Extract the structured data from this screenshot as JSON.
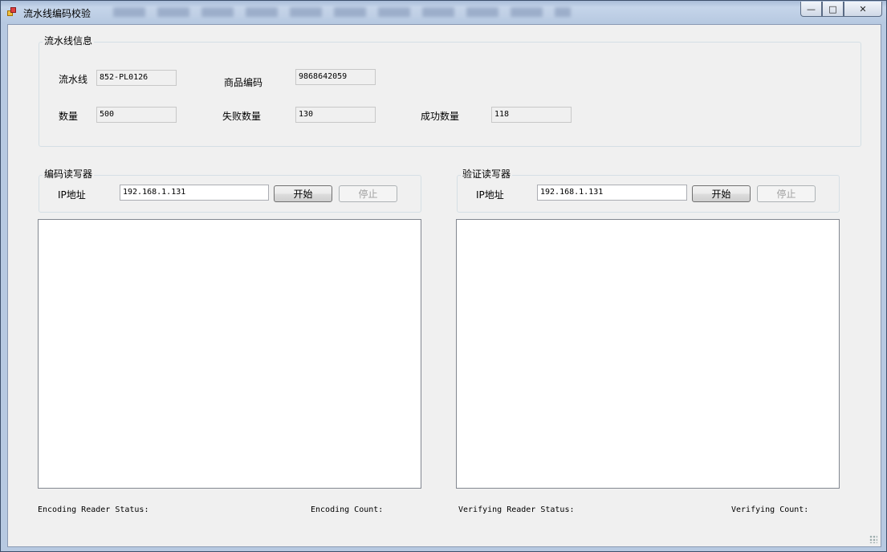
{
  "window": {
    "title": "流水线编码校验",
    "controls": {
      "minimize": "—",
      "maximize": "□",
      "close": "✕"
    }
  },
  "line_info": {
    "group_title": "流水线信息",
    "line_label": "流水线",
    "line_value": "852-PL0126",
    "product_code_label": "商品编码",
    "product_code_value": "9868642059",
    "quantity_label": "数量",
    "quantity_value": "500",
    "fail_count_label": "失败数量",
    "fail_count_value": "130",
    "success_count_label": "成功数量",
    "success_count_value": "118"
  },
  "encoding_reader": {
    "group_title": "编码读写器",
    "ip_label": "IP地址",
    "ip_value": "192.168.1.131",
    "start_label": "开始",
    "stop_label": "停止",
    "status_label": "Encoding Reader Status:",
    "count_label": "Encoding Count:"
  },
  "verifying_reader": {
    "group_title": "验证读写器",
    "ip_label": "IP地址",
    "ip_value": "192.168.1.131",
    "start_label": "开始",
    "stop_label": "停止",
    "status_label": "Verifying Reader Status:",
    "count_label": "Verifying Count:"
  }
}
